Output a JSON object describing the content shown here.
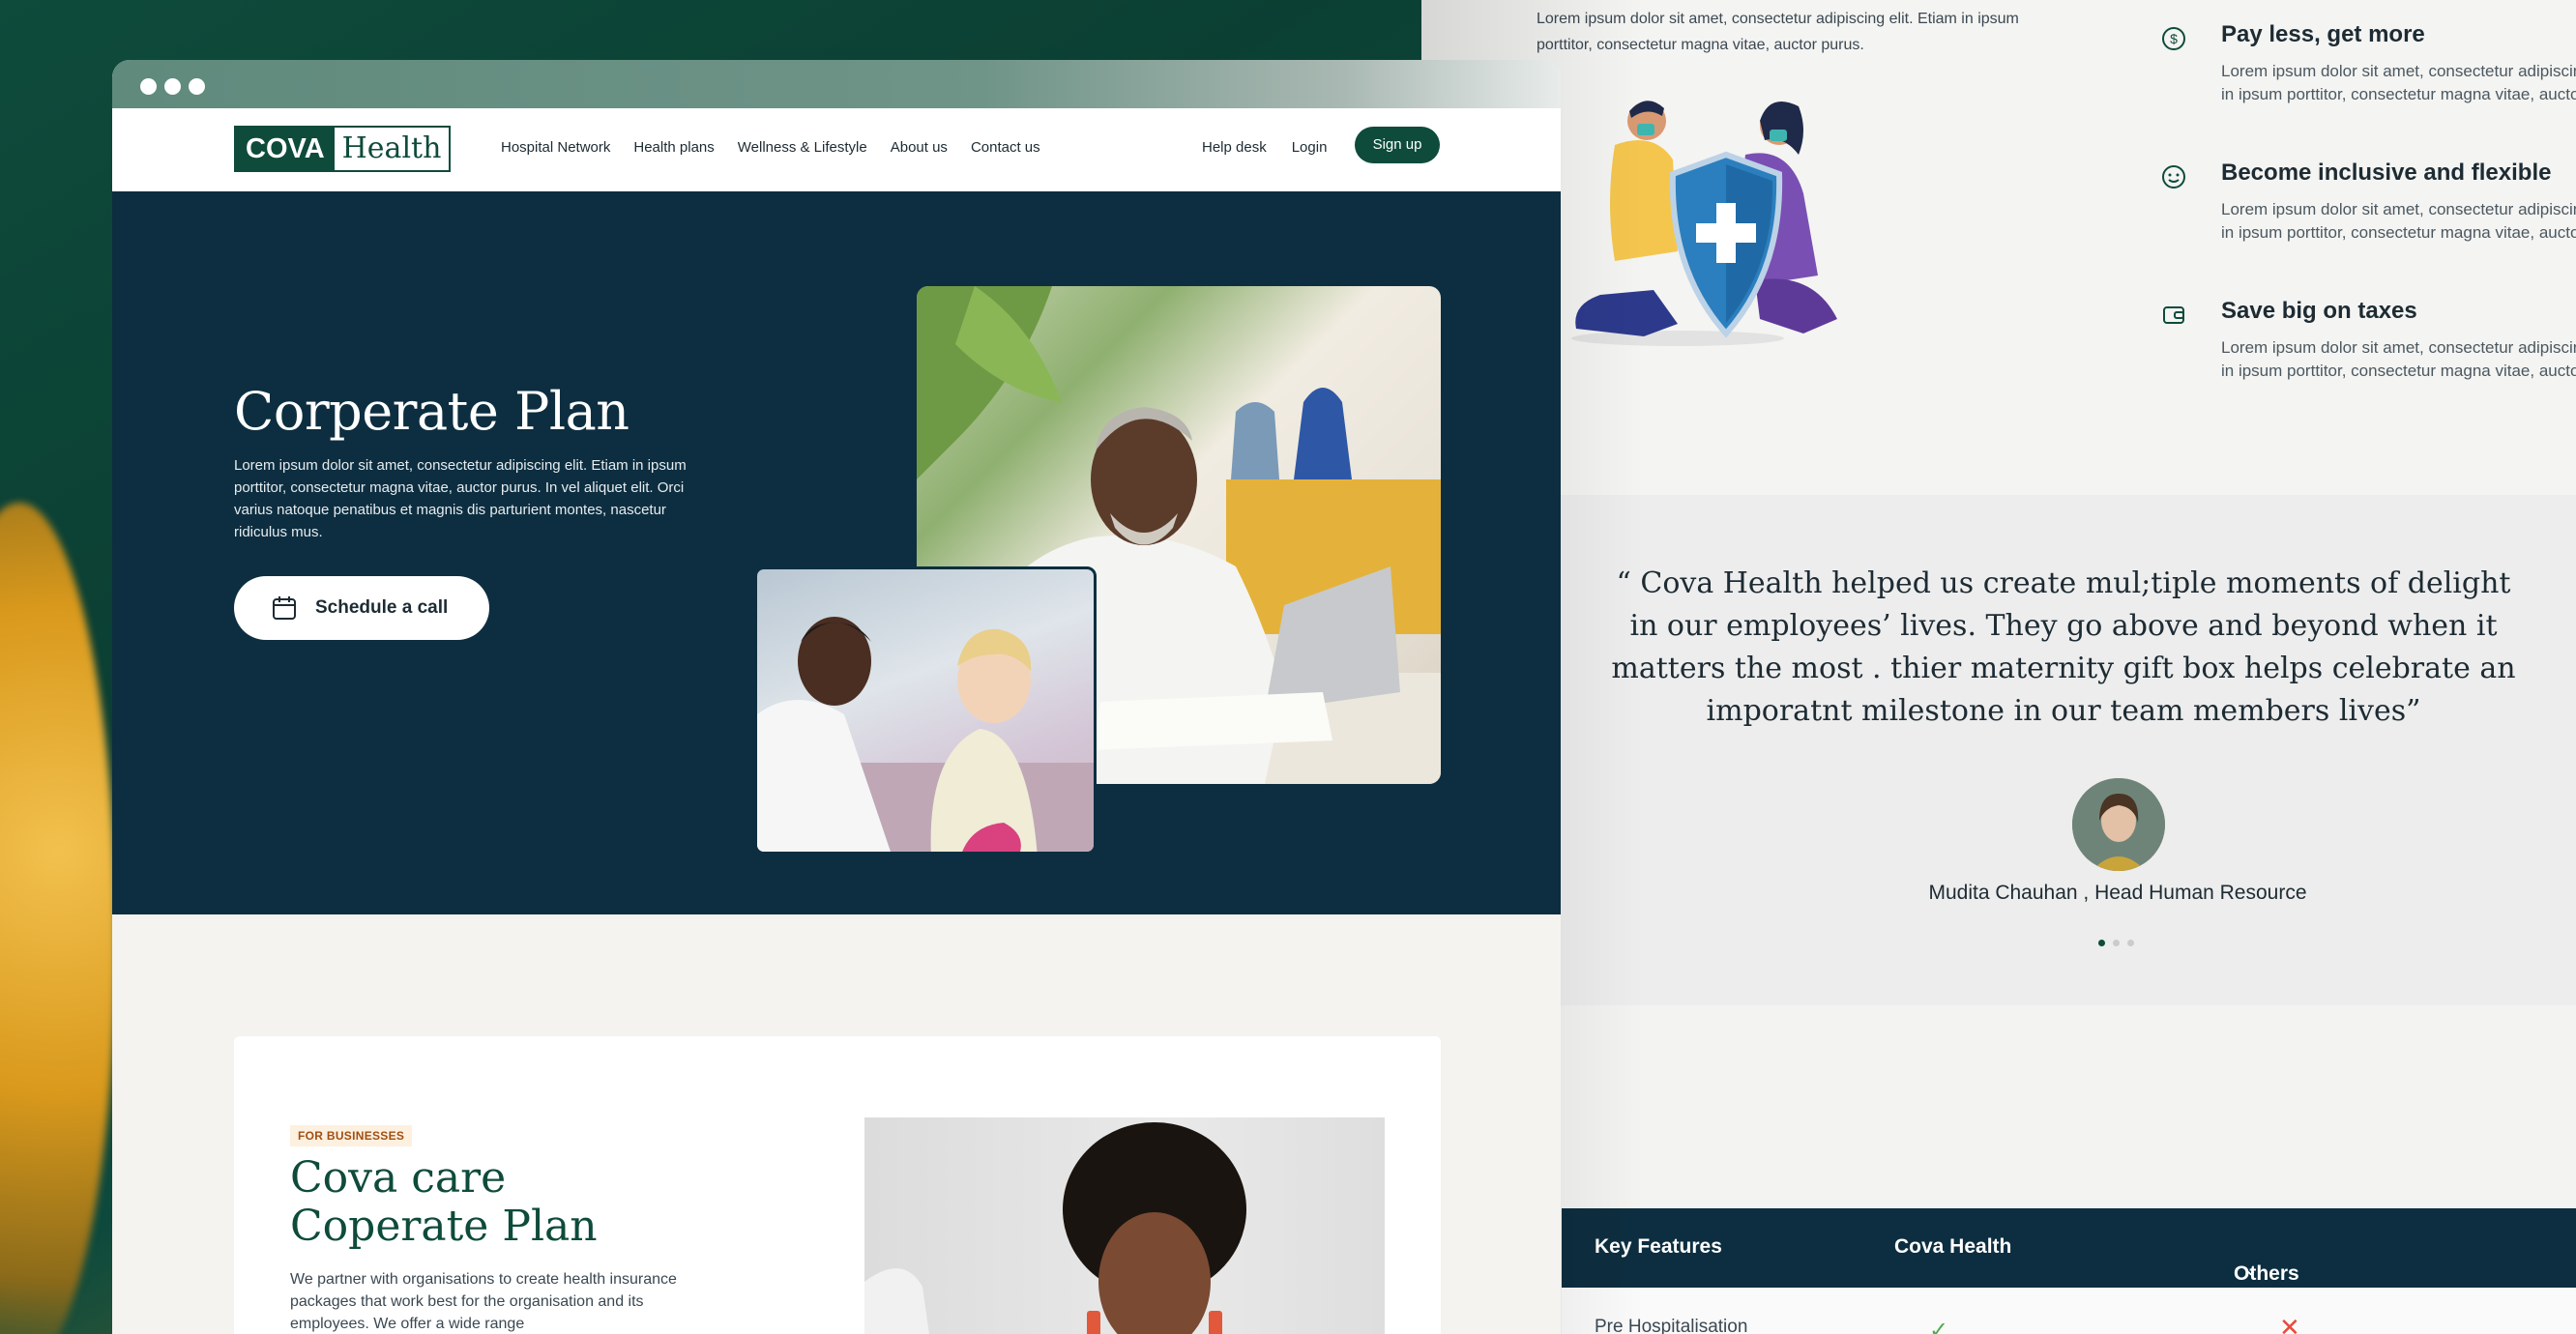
{
  "browser": {
    "traffic_lights": 3
  },
  "nav": {
    "logo_cova": "COVA",
    "logo_health": "Health",
    "links": [
      "Hospital Network",
      "Health plans",
      "Wellness & Lifestyle",
      "About us",
      "Contact us"
    ],
    "help": "Help desk",
    "login": "Login",
    "signup": "Sign up"
  },
  "hero": {
    "title": "Corperate Plan",
    "body": "Lorem ipsum dolor sit amet, consectetur adipiscing elit. Etiam in ipsum porttitor, consectetur magna vitae, auctor purus. In vel aliquet elit. Orci varius natoque penatibus et magnis dis parturient montes, nascetur ridiculus mus.",
    "cta": "Schedule a call"
  },
  "card": {
    "badge": "FOR BUSINESSES",
    "title": "Cova care Coperate Plan",
    "body": "We partner with organisations to create health insurance packages that work best for the organisation and its employees. We offer a wide range"
  },
  "right": {
    "intro": "Lorem ipsum dolor sit amet, consectetur adipiscing elit. Etiam in ipsum porttitor, consectetur magna vitae, auctor purus.",
    "benefits": [
      {
        "icon": "dollar-circle-icon",
        "title": "Pay less, get more",
        "line1": "Lorem ipsum dolor sit amet, consectetur adipiscing",
        "line2": "in ipsum porttitor, consectetur magna vitae, auctor"
      },
      {
        "icon": "smiley-icon",
        "title": "Become inclusive and flexible",
        "line1": "Lorem ipsum dolor sit amet, consectetur adipiscing",
        "line2": "in ipsum porttitor, consectetur magna vitae, auctor"
      },
      {
        "icon": "wallet-icon",
        "title": "Save big on taxes",
        "line1": "Lorem ipsum dolor sit amet, consectetur adipiscing",
        "line2": "in ipsum porttitor, consectetur magna vitae, auctor"
      }
    ],
    "quote": "“ Cova Health helped us create mul;tiple moments of delight in our employees’ lives. They go above and beyond when it matters the most . thier maternity gift box helps celebrate an imporatnt milestone in our team members lives”",
    "quote_author": "Mudita Chauhan , Head Human Resource",
    "table": {
      "col1": "Key Features",
      "col2": "Cova Health",
      "col3": "Others",
      "row1_label": "Pre Hospitalisation"
    }
  },
  "colors": {
    "brand_green": "#0e4b3b",
    "hero_navy": "#0d2e40",
    "badge_orange": "#a14e13"
  }
}
